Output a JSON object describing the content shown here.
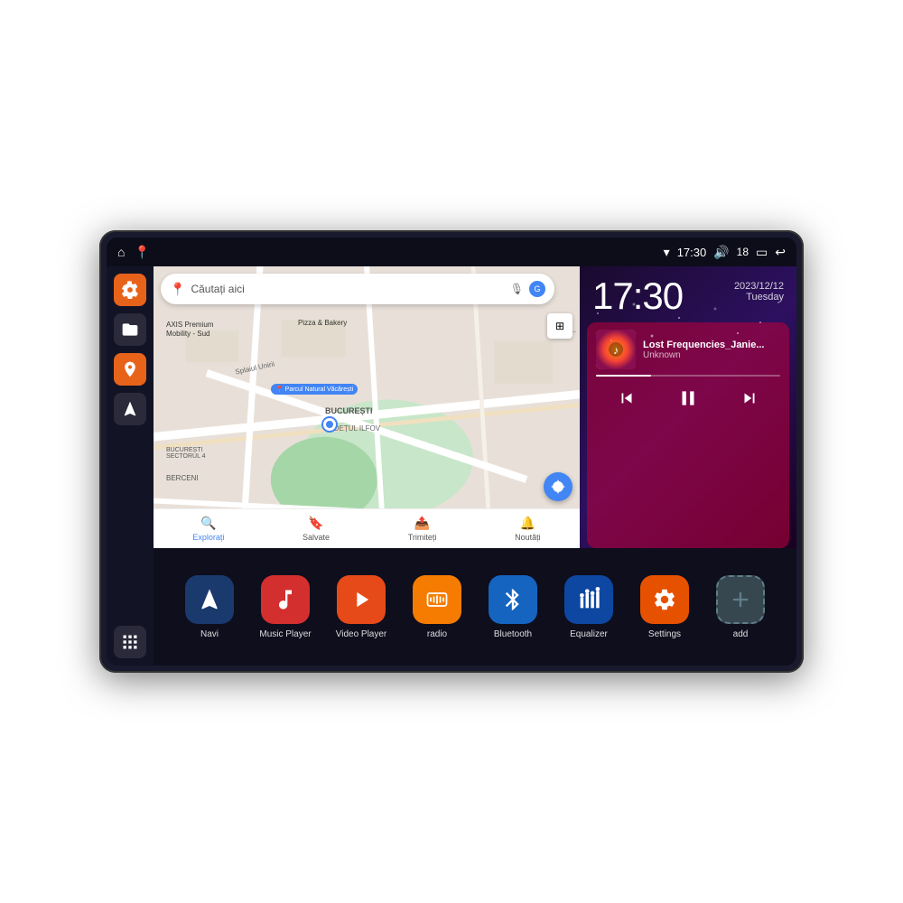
{
  "device": {
    "status_bar": {
      "wifi_icon": "▼",
      "time": "17:30",
      "volume_icon": "🔊",
      "battery_num": "18",
      "battery_icon": "🔋",
      "back_icon": "↩"
    },
    "home_icon": "⌂",
    "map_icon": "📍"
  },
  "map": {
    "search_placeholder": "Căutați aici",
    "places": [
      "AXIS Premium Mobility - Sud",
      "Pizza & Bakery",
      "Parcul Natural Văcărești",
      "BUCUREȘTI",
      "JUDEȚUL ILFOV",
      "BUCUREȘTI SECTORUL 4",
      "BERCENI"
    ],
    "nav_items": [
      {
        "label": "Explorați",
        "icon": "🔍",
        "active": true
      },
      {
        "label": "Salvate",
        "icon": "🔖",
        "active": false
      },
      {
        "label": "Trimiteți",
        "icon": "📤",
        "active": false
      },
      {
        "label": "Noutăți",
        "icon": "🔔",
        "active": false
      }
    ]
  },
  "clock": {
    "time": "17:30",
    "date": "2023/12/12",
    "day": "Tuesday"
  },
  "music": {
    "title": "Lost Frequencies_Janie...",
    "artist": "Unknown",
    "progress": 30
  },
  "apps": [
    {
      "label": "Navi",
      "icon": "▲",
      "color": "blue-dark"
    },
    {
      "label": "Music Player",
      "icon": "♪",
      "color": "red"
    },
    {
      "label": "Video Player",
      "icon": "▶",
      "color": "orange-red"
    },
    {
      "label": "radio",
      "icon": "📻",
      "color": "orange"
    },
    {
      "label": "Bluetooth",
      "icon": "⚡",
      "color": "blue"
    },
    {
      "label": "Equalizer",
      "icon": "⚏",
      "color": "dark-blue"
    },
    {
      "label": "Settings",
      "icon": "⚙",
      "color": "orange2"
    },
    {
      "label": "add",
      "icon": "+",
      "color": "gray"
    }
  ],
  "sidebar": {
    "buttons": [
      {
        "icon": "⚙",
        "color": "orange"
      },
      {
        "icon": "🗂",
        "color": "dark"
      },
      {
        "icon": "📍",
        "color": "orange"
      },
      {
        "icon": "▲",
        "color": "dark"
      }
    ],
    "grid_icon": "⋮⋮⋮"
  }
}
